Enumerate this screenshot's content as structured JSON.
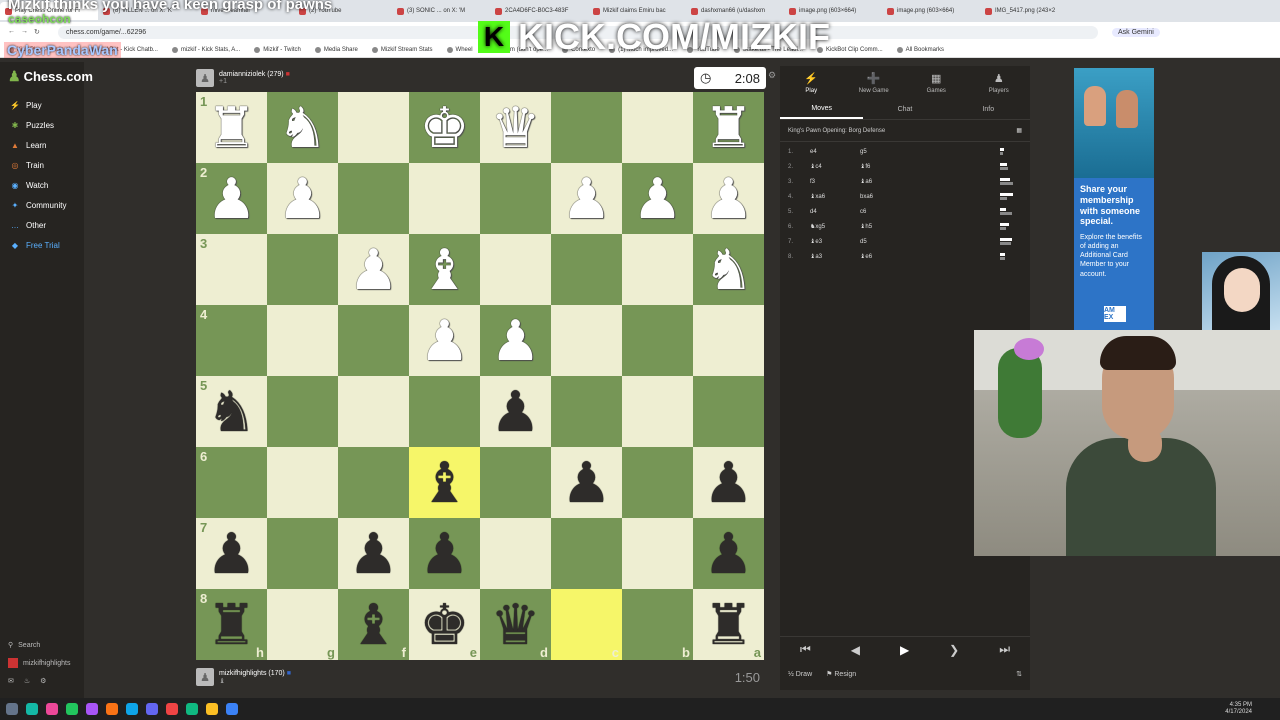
{
  "overlay": {
    "title": "Mizkif thinks you have a keen grasp of pawns",
    "sub": "caseohcon",
    "name": "CyberPandaWan",
    "kick": "KICK.COM/MIZKIF"
  },
  "browser": {
    "tabs": [
      "Play Chess Online for Fr",
      "(8) VILLEN ... on X: 'K",
      "r/livestreamfail",
      "(2) YouTube",
      "(3) SONIC ... on X: 'M",
      "2CA4D6FC-B0C3-483F",
      "Mizkif claims Emiru bac",
      "dashxman66 (u/dashxm",
      "image.png (603×664)",
      "image.png (603×664)",
      "IMG_5417.png (243×2"
    ],
    "url": "chess.com/game/...62296",
    "ask": "Ask Gemini",
    "bookmarks": [
      "Kick Plays Words - l...",
      "KickBot - Kick Chatb...",
      "mizkif - Kick Stats, A...",
      "Mizkif - Twitch",
      "Media Share",
      "Mizkif Stream Stats",
      "Wheel",
      "Stream (don't ope...",
      "Contexto",
      "(1) Much improved...",
      "YouTube",
      "Stake.us - The Leadi...",
      "KickBot Clip Comm...",
      "All Bookmarks"
    ]
  },
  "sidebar": {
    "logo": "Chess.com",
    "items": [
      {
        "icon": "play-icon",
        "label": "Play"
      },
      {
        "icon": "puzzle-icon",
        "label": "Puzzles"
      },
      {
        "icon": "learn-icon",
        "label": "Learn"
      },
      {
        "icon": "train-icon",
        "label": "Train"
      },
      {
        "icon": "watch-icon",
        "label": "Watch"
      },
      {
        "icon": "community-icon",
        "label": "Community"
      },
      {
        "icon": "more-icon",
        "label": "Other"
      },
      {
        "icon": "diamond-icon",
        "label": "Free Trial"
      }
    ],
    "search": "Search",
    "user": "mizkifhighlights"
  },
  "top_player": {
    "name": "damianniziolek",
    "rating": "(279)",
    "sub": "+1",
    "clock": "2:08"
  },
  "bottom_player": {
    "name": "mizkifhighlights",
    "rating": "(170)",
    "clock": "1:50"
  },
  "board": {
    "ranks": [
      "1",
      "2",
      "3",
      "4",
      "5",
      "6",
      "7",
      "8"
    ],
    "files": [
      "h",
      "g",
      "f",
      "e",
      "d",
      "c",
      "b",
      "a"
    ],
    "rows": [
      [
        "wR",
        "wN",
        "",
        "wK",
        "wQ",
        "",
        "",
        "wR"
      ],
      [
        "wP",
        "wP",
        "",
        "",
        "",
        "wP",
        "wP",
        "wP"
      ],
      [
        "",
        "",
        "wP",
        "wB",
        "",
        "",
        "",
        "wN"
      ],
      [
        "",
        "",
        "",
        "wP",
        "wP",
        "",
        "",
        ""
      ],
      [
        "bN",
        "",
        "",
        "",
        "bP",
        "",
        "",
        ""
      ],
      [
        "",
        "",
        "",
        "bB",
        "",
        "bP",
        "",
        "bP"
      ],
      [
        "bP",
        "",
        "bP",
        "bP",
        "",
        "",
        "",
        "bP"
      ],
      [
        "bR",
        "",
        "bB",
        "bK",
        "bQ",
        "",
        "",
        "bR"
      ]
    ],
    "highlight": [
      [
        5,
        3
      ],
      [
        7,
        5
      ]
    ]
  },
  "panel": {
    "tabs": [
      {
        "icon": "bolt-icon",
        "label": "Play"
      },
      {
        "icon": "plus-icon",
        "label": "New Game"
      },
      {
        "icon": "grid-icon",
        "label": "Games"
      },
      {
        "icon": "players-icon",
        "label": "Players"
      }
    ],
    "subtabs": [
      "Moves",
      "Chat",
      "Info"
    ],
    "opening": "King's Pawn Opening: Borg Defense",
    "moves": [
      {
        "n": "1.",
        "w": "e4",
        "b": "g5"
      },
      {
        "n": "2.",
        "w": "♝c4",
        "b": "♝f6"
      },
      {
        "n": "3.",
        "w": "f3",
        "b": "♝a6"
      },
      {
        "n": "4.",
        "w": "♝xa6",
        "b": "bxa6"
      },
      {
        "n": "5.",
        "w": "d4",
        "b": "c6"
      },
      {
        "n": "6.",
        "w": "♞xg5",
        "b": "♝h5"
      },
      {
        "n": "7.",
        "w": "♝e3",
        "b": "d5"
      },
      {
        "n": "8.",
        "w": "♝a3",
        "b": "♝e6"
      }
    ],
    "draw": "Draw",
    "resign": "Resign"
  },
  "ad": {
    "headline": "Share your membership with someone special.",
    "body": "Explore the benefits of adding an Additional Card Member to your account.",
    "logo": "AM EX"
  },
  "taskbar": {
    "time": "4:35 PM",
    "date": "4/17/2024"
  }
}
